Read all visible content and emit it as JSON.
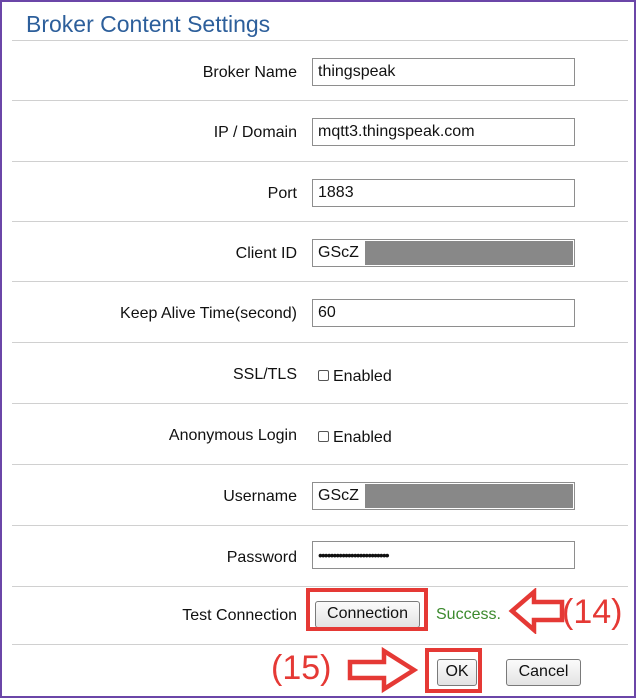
{
  "title": "Broker Content Settings",
  "fields": {
    "broker_name": {
      "label": "Broker Name",
      "value": "thingspeak"
    },
    "ip_domain": {
      "label": "IP / Domain",
      "value": "mqtt3.thingspeak.com"
    },
    "port": {
      "label": "Port",
      "value": "1883"
    },
    "client_id": {
      "label": "Client ID",
      "value": "GScZ"
    },
    "keep_alive": {
      "label": "Keep Alive Time(second)",
      "value": "60"
    },
    "ssl_tls": {
      "label": "SSL/TLS",
      "option": "Enabled",
      "checked": false
    },
    "anonymous_login": {
      "label": "Anonymous Login",
      "option": "Enabled",
      "checked": false
    },
    "username": {
      "label": "Username",
      "value": "GScZ"
    },
    "password": {
      "label": "Password",
      "value": "••••••••••••••••••••••••"
    }
  },
  "test_connection": {
    "label": "Test Connection",
    "button": "Connection",
    "status": "Success."
  },
  "actions": {
    "ok": "OK",
    "cancel": "Cancel"
  },
  "annotations": {
    "step14": "(14)",
    "step15": "(15)"
  },
  "colors": {
    "annotation_red": "#e53935",
    "frame_purple": "#6b46a8",
    "title_blue": "#2d5f9b",
    "success_green": "#3c8a2e"
  }
}
